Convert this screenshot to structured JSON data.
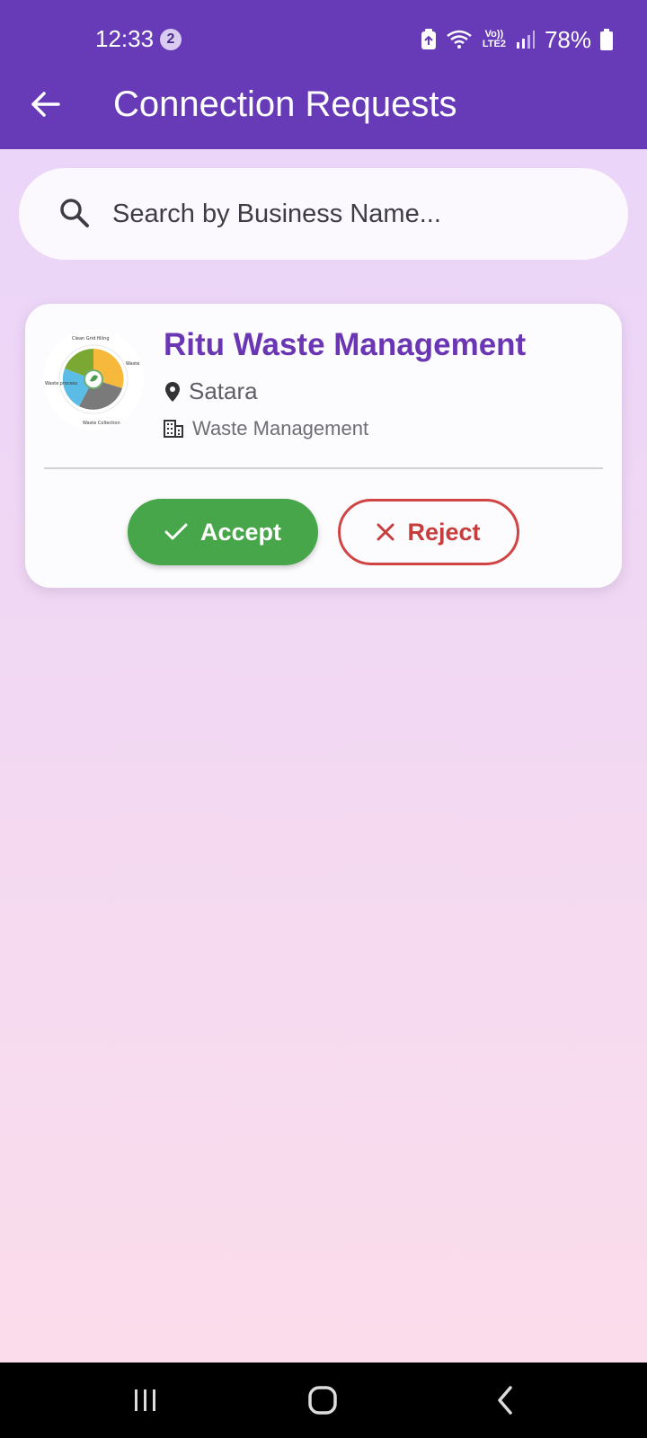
{
  "status_bar": {
    "time": "12:33",
    "notification_count": "2",
    "network_label": "Vo)) LTE2",
    "battery_percent": "78%"
  },
  "app_bar": {
    "title": "Connection Requests",
    "back_icon": "arrow-back-icon"
  },
  "search": {
    "placeholder": "Search by Business Name...",
    "value": "",
    "icon": "search-icon"
  },
  "requests": [
    {
      "business_name": "Ritu Waste Management",
      "location": "Satara",
      "category": "Waste Management",
      "logo_icon": "waste-cycle-logo",
      "logo_labels": [
        "Clean Grid filling",
        "Waste",
        "Waste process",
        "Waste Collection"
      ],
      "accept_label": "Accept",
      "reject_label": "Reject"
    }
  ],
  "colors": {
    "primary": "#673AB7",
    "business_name": "#6A36B4",
    "accept": "#47A64A",
    "reject": "#D04444",
    "background_top": "#E9D5FB",
    "background_bottom": "#FCDDEA"
  },
  "nav_bar": {
    "recents_icon": "recents-icon",
    "home_icon": "home-icon",
    "back_icon": "nav-back-icon"
  }
}
